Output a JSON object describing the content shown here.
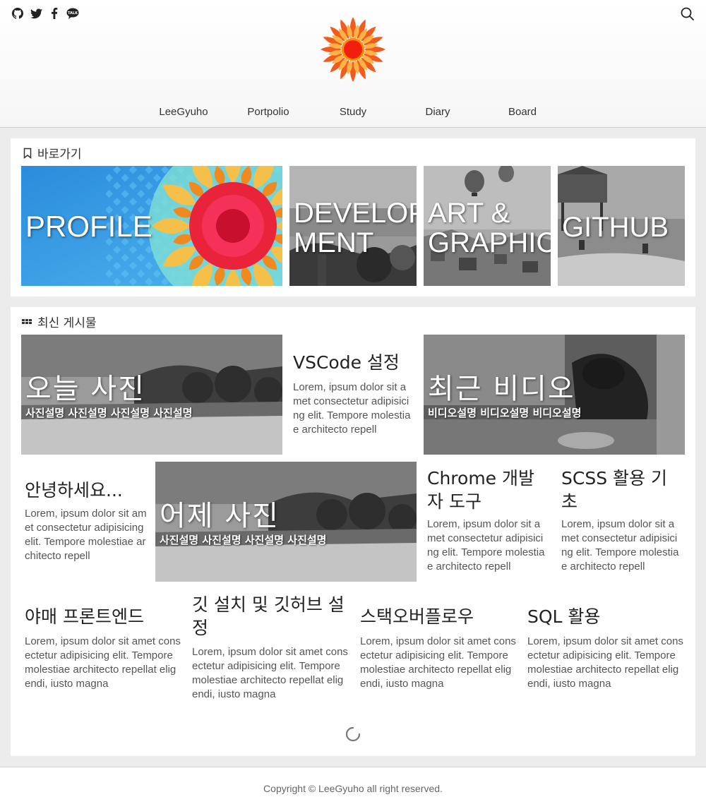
{
  "header": {
    "social": [
      {
        "icon": "github-icon",
        "label": "GitHub"
      },
      {
        "icon": "twitter-icon",
        "label": "Twitter"
      },
      {
        "icon": "facebook-icon",
        "label": "Facebook"
      },
      {
        "icon": "kakaotalk-icon",
        "label": "TALK"
      }
    ],
    "logo_icon": "sun-mandala-logo",
    "nav": [
      "LeeGyuho",
      "Portpolio",
      "Study",
      "Diary",
      "Board"
    ]
  },
  "shortcuts": {
    "title": "바로가기",
    "tiles": [
      {
        "label": "PROFILE",
        "label2": ""
      },
      {
        "label": "DEVELOP",
        "label2": "MENT"
      },
      {
        "label": "ART &",
        "label2": "GRAPHIC"
      },
      {
        "label": "GITHUB",
        "label2": ""
      }
    ]
  },
  "recent": {
    "title": "최신 게시물",
    "lorem_short": "Lorem, ipsum dolor sit amet consectetur adipisicing elit. Tempore molestiae architecto repell",
    "lorem_long": "Lorem, ipsum dolor sit amet consectetur adipisicing elit. Tempore molestiae architecto repellat eligendi, iusto magna",
    "photo_today": {
      "title": "오늘 사진",
      "desc": "사진설명 사진설명 사진설명 사진설명"
    },
    "vscode": {
      "title": "VSCode 설정"
    },
    "video": {
      "title": "최근 비디오",
      "desc": "비디오설명 비디오설명 비디오설명"
    },
    "hello": {
      "title": "안녕하세요..."
    },
    "photo_yesterday": {
      "title": "어제 사진",
      "desc": "사진설명 사진설명 사진설명 사진설명"
    },
    "chrome": {
      "title": "Chrome 개발자 도구"
    },
    "scss": {
      "title": "SCSS 활용 기초"
    },
    "frontend": {
      "title": "야매 프론트엔드"
    },
    "git": {
      "title": "깃 설치 및 깃허브 설정"
    },
    "stackoverflow": {
      "title": "스택오버플로우"
    },
    "sql": {
      "title": "SQL 활용"
    }
  },
  "footer": {
    "copyright": "Copyright © LeeGyuho all right reserved."
  }
}
